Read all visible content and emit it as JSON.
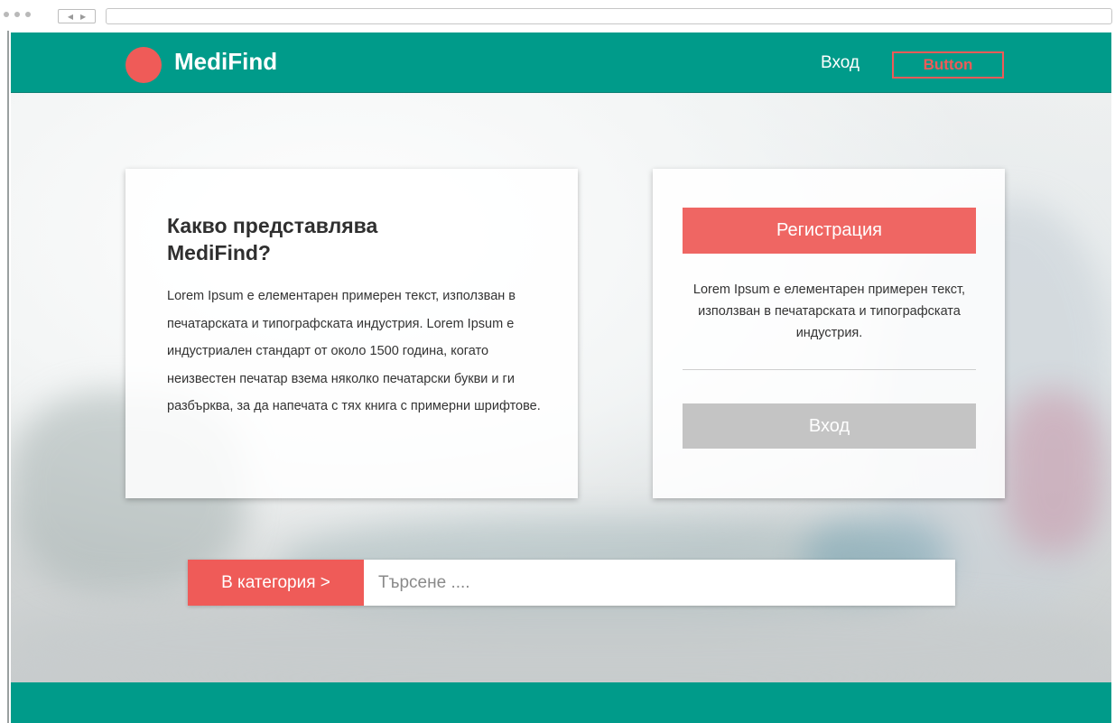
{
  "header": {
    "logo_text": "MediFind",
    "login_link": "Вход",
    "button_label": "Button"
  },
  "info_card": {
    "title": "Какво представлява MediFind?",
    "body": "Lorem Ipsum е елементарен примерен текст, използван в печатарската и типографската индустрия. Lorem Ipsum е индустриален стандарт от около 1500 година, когато неизвестен печатар взема няколко печатарски букви и ги разбърква, за да напечата с тях книга с примерни шрифтове."
  },
  "register_card": {
    "register_label": "Регистрация",
    "text": "Lorem Ipsum е елементарен примерен текст, използван в печатарската и типографската индустрия.",
    "login_label": "Вход"
  },
  "search": {
    "category_label": "В категория  >",
    "placeholder": "Търсене ...."
  },
  "colors": {
    "teal": "#009b8a",
    "accent_red": "#ef5b58",
    "disabled_gray": "#c4c4c4"
  }
}
